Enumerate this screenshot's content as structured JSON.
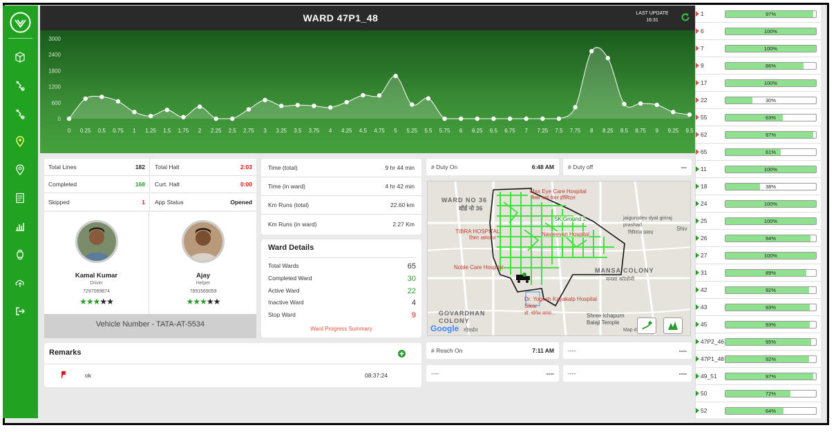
{
  "header": {
    "title": "WARD 47P1_48",
    "last_update_label": "LAST UPDATE",
    "last_update_time": "16:31"
  },
  "chart_data": {
    "type": "area",
    "x": [
      0,
      0.25,
      0.5,
      0.75,
      1,
      1.25,
      1.5,
      1.75,
      2,
      2.25,
      2.5,
      2.75,
      3,
      3.25,
      3.5,
      3.75,
      4,
      4.25,
      4.5,
      4.75,
      5,
      5.25,
      5.5,
      5.75,
      6,
      6.25,
      6.5,
      6.75,
      7,
      7.25,
      7.5,
      7.75,
      8,
      8.25,
      8.5,
      8.75,
      9,
      9.25,
      9.5
    ],
    "x_tick_labels": [
      "0",
      "0.25",
      "0.5",
      "0.75",
      "1",
      "1.25",
      "1.5",
      "1.75",
      "2",
      "2.25",
      "2.5",
      "2.75",
      "3",
      "3.25",
      "3.5",
      "3.75",
      "4",
      "4.25",
      "4.5",
      "4.75",
      "5",
      "5.25",
      "5.5",
      "5.75",
      "6",
      "6.25",
      "6.5",
      "6.75",
      "7",
      "7.25",
      "7.5",
      "7.75",
      "8",
      "8.25",
      "8.5",
      "8.75",
      "9",
      "9.25",
      "9.5"
    ],
    "values": [
      0,
      750,
      820,
      650,
      250,
      100,
      330,
      60,
      450,
      0,
      0,
      350,
      700,
      480,
      510,
      480,
      420,
      620,
      880,
      870,
      1600,
      530,
      760,
      0,
      0,
      0,
      0,
      0,
      0,
      0,
      0,
      430,
      2530,
      2270,
      550,
      570,
      520,
      250,
      150
    ],
    "y_ticks": [
      0,
      600,
      1200,
      1800,
      2400,
      3000
    ],
    "ylim": [
      0,
      3000
    ]
  },
  "stats": {
    "total_lines_label": "Total Lines",
    "total_lines": "182",
    "total_halt_label": "Total Halt",
    "total_halt": "2:03",
    "completed_label": "Completed",
    "completed": "168",
    "curt_halt_label": "Curt. Halt",
    "curt_halt": "0:00",
    "skipped_label": "Skipped",
    "skipped": "1",
    "app_status_label": "App Status",
    "app_status": "Opened"
  },
  "driver": {
    "name": "Kamal Kumar",
    "role": "Driver",
    "phone": "7297069874",
    "rating": 3
  },
  "helper": {
    "name": "Ajay",
    "role": "Helper",
    "phone": "7891569059",
    "rating": 3
  },
  "vehicle": "Vehicle Number - TATA-AT-5534",
  "remarks": {
    "title": "Remarks",
    "text": "ok",
    "time": "08:37:24"
  },
  "times": {
    "time_total_label": "Time (total)",
    "time_total": "9 hr 44 min",
    "time_ward_label": "Time (in ward)",
    "time_ward": "4 hr 42 min",
    "km_total_label": "Km Runs (total)",
    "km_total": "22.60 km",
    "km_ward_label": "Km Runs (in ward)",
    "km_ward": "2.27 Km"
  },
  "ward_details": {
    "title": "Ward Details",
    "total_label": "Total Wards",
    "total": "65",
    "completed_label": "Completed Ward",
    "completed": "30",
    "active_label": "Active Ward",
    "active": "22",
    "inactive_label": "Inactive Ward",
    "inactive": "4",
    "stop_label": "Stop Ward",
    "stop": "9",
    "link": "Ward Progress Summary"
  },
  "duty": {
    "on_label": "# Duty On",
    "on_time": "6:48 AM",
    "off_label": "# Duty off",
    "off_time": "---",
    "reach_label": "# Reach On",
    "reach_time": "7:11 AM",
    "c1_label": "----",
    "c1_value": "----",
    "c2_label": "----",
    "c2_value": "----",
    "c3_label": "----",
    "c3_value": "----"
  },
  "map": {
    "labels": {
      "ward_no": "WARD NO 36",
      "ward_no_hi": "वॉर्ड नो 36",
      "max_eye": "Max Eye Care Hospital",
      "max_eye_hi": "मैक्स आई केयर हॉस्पिटल",
      "sk_ground": "SK Ground 2",
      "tibra": "TIBRA HOSPITAL",
      "tibra_hi": "टिबरा अस्पताल",
      "navjeevan": "Navjeevan Hospital",
      "jaigurudev": "jaigurudev dyal giriraj prashad",
      "jaigurudev_hi": "गिरिराज प्रसाद",
      "noble": "Noble Care Hospital",
      "mansa": "MANSA COLONY",
      "mansa_hi": "मनसा कॉलोनी",
      "govardhan": "GOVARDHAN COLONY",
      "govardhan_hi": "गोवर्धन",
      "yogesh": "Dr. Yogesh Kayakalp Hospital Sikar",
      "yogesh_hi": "डॉ. योगेश काया...",
      "shree": "Shree Ichapurn Balaji Temple",
      "shiv": "Shiv",
      "google": "Google",
      "map_data": "Map da"
    }
  },
  "ward_list": [
    {
      "id": "1",
      "pct": 97,
      "label": "97%"
    },
    {
      "id": "6",
      "pct": 100,
      "label": "100%"
    },
    {
      "id": "7",
      "pct": 100,
      "label": "100%"
    },
    {
      "id": "9",
      "pct": 86,
      "label": "86%"
    },
    {
      "id": "17",
      "pct": 100,
      "label": "100%"
    },
    {
      "id": "22",
      "pct": 30,
      "label": "30%"
    },
    {
      "id": "55",
      "pct": 63,
      "label": "63%"
    },
    {
      "id": "62",
      "pct": 97,
      "label": "97%"
    },
    {
      "id": "65",
      "pct": 61,
      "label": "61%"
    },
    {
      "id": "11",
      "pct": 100,
      "label": "100%"
    },
    {
      "id": "18",
      "pct": 38,
      "label": "38%"
    },
    {
      "id": "24",
      "pct": 100,
      "label": "100%"
    },
    {
      "id": "25",
      "pct": 100,
      "label": "100%"
    },
    {
      "id": "26",
      "pct": 94,
      "label": "94%"
    },
    {
      "id": "27",
      "pct": 100,
      "label": "100%"
    },
    {
      "id": "31",
      "pct": 89,
      "label": "89%"
    },
    {
      "id": "42",
      "pct": 92,
      "label": "92%"
    },
    {
      "id": "43",
      "pct": 93,
      "label": "93%"
    },
    {
      "id": "45",
      "pct": 93,
      "label": "93%"
    },
    {
      "id": "47P2_46",
      "pct": 95,
      "label": "95%"
    },
    {
      "id": "47P1_48",
      "pct": 92,
      "label": "92%"
    },
    {
      "id": "49_51",
      "pct": 97,
      "label": "97%"
    },
    {
      "id": "50",
      "pct": 72,
      "label": "72%"
    },
    {
      "id": "52",
      "pct": 64,
      "label": "64%"
    }
  ],
  "colors": {
    "sidebar": "#21a321",
    "accent_green": "#2a9a2a",
    "alert_red": "#dd1111"
  }
}
